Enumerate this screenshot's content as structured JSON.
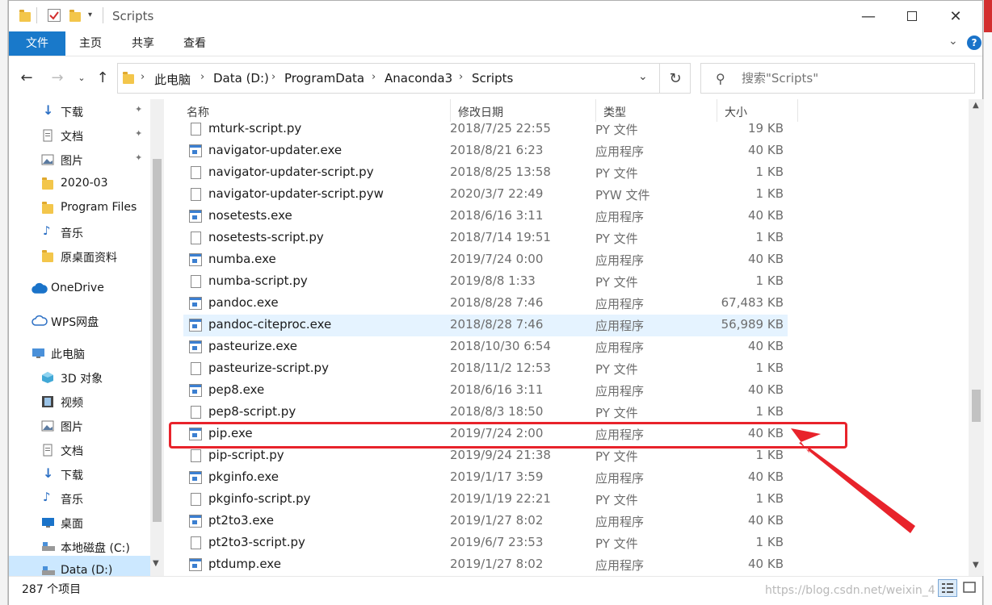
{
  "window": {
    "title": "Scripts"
  },
  "ribbon": {
    "tabs": [
      "文件",
      "主页",
      "共享",
      "查看"
    ],
    "help_glyph": "?"
  },
  "address": {
    "breadcrumbs": [
      "此电脑",
      "Data (D:)",
      "ProgramData",
      "Anaconda3",
      "Scripts"
    ]
  },
  "search": {
    "placeholder": "搜索\"Scripts\""
  },
  "nav": {
    "items": [
      {
        "label": "下载",
        "icon": "download-icon",
        "pinned": true
      },
      {
        "label": "文档",
        "icon": "document-icon",
        "pinned": true
      },
      {
        "label": "图片",
        "icon": "picture-icon",
        "pinned": true
      },
      {
        "label": "2020-03",
        "icon": "folder-icon",
        "pinned": false
      },
      {
        "label": "Program Files",
        "icon": "folder-icon",
        "pinned": false
      },
      {
        "label": "音乐",
        "icon": "music-icon",
        "pinned": false
      },
      {
        "label": "原桌面资料",
        "icon": "folder-icon",
        "pinned": false
      },
      {
        "label": "OneDrive",
        "icon": "cloud-icon",
        "pinned": false
      },
      {
        "label": "WPS网盘",
        "icon": "cloud-outline-icon",
        "pinned": false
      },
      {
        "label": "此电脑",
        "icon": "computer-icon",
        "pinned": false
      },
      {
        "label": "3D 对象",
        "icon": "cube-icon",
        "pinned": false
      },
      {
        "label": "视频",
        "icon": "video-icon",
        "pinned": false
      },
      {
        "label": "图片",
        "icon": "picture-icon",
        "pinned": false
      },
      {
        "label": "文档",
        "icon": "document-icon",
        "pinned": false
      },
      {
        "label": "下载",
        "icon": "download-icon",
        "pinned": false
      },
      {
        "label": "音乐",
        "icon": "music-icon",
        "pinned": false
      },
      {
        "label": "桌面",
        "icon": "desktop-icon",
        "pinned": false
      },
      {
        "label": "本地磁盘 (C:)",
        "icon": "drive-icon",
        "pinned": false
      },
      {
        "label": "Data (D:)",
        "icon": "drive-icon",
        "pinned": false
      }
    ]
  },
  "columns": {
    "name": "名称",
    "date": "修改日期",
    "type": "类型",
    "size": "大小"
  },
  "files": [
    {
      "name": "mturk-script.py",
      "date": "2018/7/25 22:55",
      "type": "PY 文件",
      "size": "19 KB",
      "kind": "doc"
    },
    {
      "name": "navigator-updater.exe",
      "date": "2018/8/21 6:23",
      "type": "应用程序",
      "size": "40 KB",
      "kind": "exe"
    },
    {
      "name": "navigator-updater-script.py",
      "date": "2018/8/25 13:58",
      "type": "PY 文件",
      "size": "1 KB",
      "kind": "doc"
    },
    {
      "name": "navigator-updater-script.pyw",
      "date": "2020/3/7 22:49",
      "type": "PYW 文件",
      "size": "1 KB",
      "kind": "doc"
    },
    {
      "name": "nosetests.exe",
      "date": "2018/6/16 3:11",
      "type": "应用程序",
      "size": "40 KB",
      "kind": "exe"
    },
    {
      "name": "nosetests-script.py",
      "date": "2018/7/14 19:51",
      "type": "PY 文件",
      "size": "1 KB",
      "kind": "doc"
    },
    {
      "name": "numba.exe",
      "date": "2019/7/24 0:00",
      "type": "应用程序",
      "size": "40 KB",
      "kind": "exe"
    },
    {
      "name": "numba-script.py",
      "date": "2019/8/8 1:33",
      "type": "PY 文件",
      "size": "1 KB",
      "kind": "doc"
    },
    {
      "name": "pandoc.exe",
      "date": "2018/8/28 7:46",
      "type": "应用程序",
      "size": "67,483 KB",
      "kind": "exe"
    },
    {
      "name": "pandoc-citeproc.exe",
      "date": "2018/8/28 7:46",
      "type": "应用程序",
      "size": "56,989 KB",
      "kind": "exe"
    },
    {
      "name": "pasteurize.exe",
      "date": "2018/10/30 6:54",
      "type": "应用程序",
      "size": "40 KB",
      "kind": "exe"
    },
    {
      "name": "pasteurize-script.py",
      "date": "2018/11/2 12:53",
      "type": "PY 文件",
      "size": "1 KB",
      "kind": "doc"
    },
    {
      "name": "pep8.exe",
      "date": "2018/6/16 3:11",
      "type": "应用程序",
      "size": "40 KB",
      "kind": "exe"
    },
    {
      "name": "pep8-script.py",
      "date": "2018/8/3 18:50",
      "type": "PY 文件",
      "size": "1 KB",
      "kind": "doc"
    },
    {
      "name": "pip.exe",
      "date": "2019/7/24 2:00",
      "type": "应用程序",
      "size": "40 KB",
      "kind": "exe"
    },
    {
      "name": "pip-script.py",
      "date": "2019/9/24 21:38",
      "type": "PY 文件",
      "size": "1 KB",
      "kind": "doc"
    },
    {
      "name": "pkginfo.exe",
      "date": "2019/1/17 3:59",
      "type": "应用程序",
      "size": "40 KB",
      "kind": "exe"
    },
    {
      "name": "pkginfo-script.py",
      "date": "2019/1/19 22:21",
      "type": "PY 文件",
      "size": "1 KB",
      "kind": "doc"
    },
    {
      "name": "pt2to3.exe",
      "date": "2019/1/27 8:02",
      "type": "应用程序",
      "size": "40 KB",
      "kind": "exe"
    },
    {
      "name": "pt2to3-script.py",
      "date": "2019/6/7 23:53",
      "type": "PY 文件",
      "size": "1 KB",
      "kind": "doc"
    },
    {
      "name": "ptdump.exe",
      "date": "2019/1/27 8:02",
      "type": "应用程序",
      "size": "40 KB",
      "kind": "exe"
    }
  ],
  "hover_row": 9,
  "highlight_row": 14,
  "status": {
    "count": "287 个项目"
  },
  "watermark": "https://blog.csdn.net/weixin_4",
  "colors": {
    "accent": "#1979ca",
    "annotation": "#e8232b",
    "hover": "#e5f3ff"
  }
}
